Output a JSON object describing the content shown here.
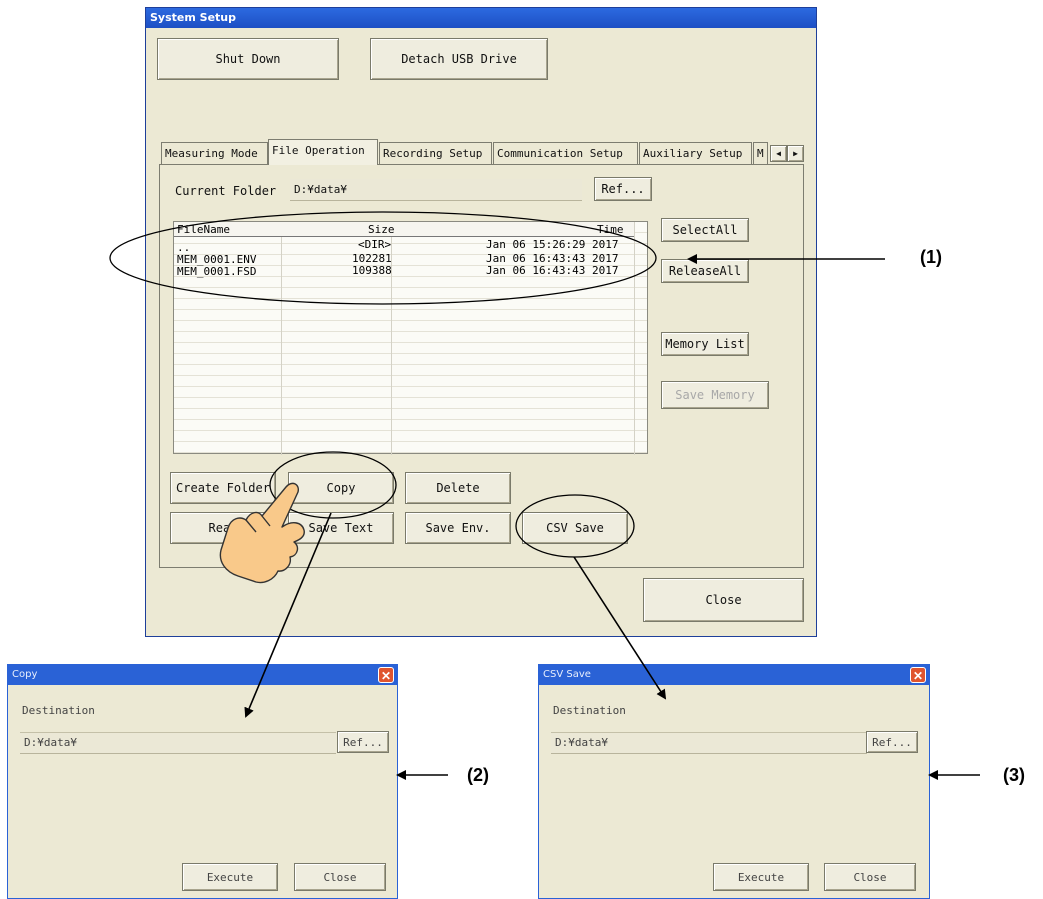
{
  "main_window": {
    "title": "System Setup",
    "shutdown_label": "Shut Down",
    "detach_label": "Detach USB Drive",
    "tabs": [
      "Measuring Mode",
      "File Operation",
      "Recording Setup",
      "Communication Setup",
      "Auxiliary Setup",
      "M"
    ],
    "current_folder_label": "Current Folder",
    "current_folder_value": "D:¥data¥",
    "ref_label": "Ref...",
    "columns": [
      "FileName",
      "Size",
      "Time"
    ],
    "rows": [
      {
        "name": "..",
        "size": "<DIR>",
        "time": "Jan 06 15:26:29 2017"
      },
      {
        "name": "MEM_0001.ENV",
        "size": "102281",
        "time": "Jan 06 16:43:43 2017"
      },
      {
        "name": "MEM_0001.FSD",
        "size": "109388",
        "time": "Jan 06 16:43:43 2017"
      }
    ],
    "select_all_label": "SelectAll",
    "release_all_label": "ReleaseAll",
    "memory_list_label": "Memory List",
    "save_memory_label": "Save Memory",
    "create_folder_label": "Create Folder",
    "copy_label": "Copy",
    "delete_label": "Delete",
    "read_label": "Read",
    "save_text_label": "Save Text",
    "save_env_label": "Save Env.",
    "csv_save_label": "CSV Save",
    "close_label": "Close"
  },
  "copy_dialog": {
    "title": "Copy",
    "destination_label": "Destination",
    "destination_value": "D:¥data¥",
    "ref_label": "Ref...",
    "execute_label": "Execute",
    "close_label": "Close"
  },
  "csv_dialog": {
    "title": "CSV Save",
    "destination_label": "Destination",
    "destination_value": "D:¥data¥",
    "ref_label": "Ref...",
    "execute_label": "Execute",
    "close_label": "Close"
  },
  "annotations": [
    "(1)",
    "(2)",
    "(3)"
  ],
  "colors": {
    "title_bar": "#1d4fc4",
    "window_bg": "#ece9d4",
    "close_red": "#e0552f"
  }
}
